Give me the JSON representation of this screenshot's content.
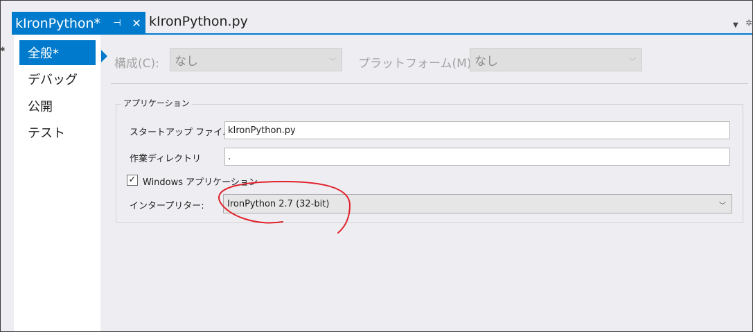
{
  "tabs": {
    "active_title": "kIronPython*",
    "pin_glyph": "⊣",
    "close_glyph": "✕",
    "inactive_title": "kIronPython.py"
  },
  "icons": {
    "pin": "pin-icon",
    "close": "close-icon",
    "dropdown": "chevron-down-icon",
    "gear": "gear-icon"
  },
  "nav": {
    "items": [
      {
        "label": "全般*",
        "selected": true
      },
      {
        "label": "デバッグ"
      },
      {
        "label": "公開"
      },
      {
        "label": "テスト"
      }
    ]
  },
  "config": {
    "configuration_label": "構成(C):",
    "configuration_value": "なし",
    "platform_label": "プラットフォーム(M):",
    "platform_value": "なし"
  },
  "application": {
    "group_title": "アプリケーション",
    "startup_label": "スタートアップ ファイル",
    "startup_value": "kIronPython.py",
    "workdir_label": "作業ディレクトリ",
    "workdir_value": ".",
    "windows_app_label": "Windows アプリケーション",
    "windows_app_checked": true,
    "interpreter_label": "インタープリター:",
    "interpreter_value": "IronPython 2.7 (32-bit)"
  },
  "colors": {
    "accent": "#007acc",
    "annotation": "#e0202a"
  }
}
